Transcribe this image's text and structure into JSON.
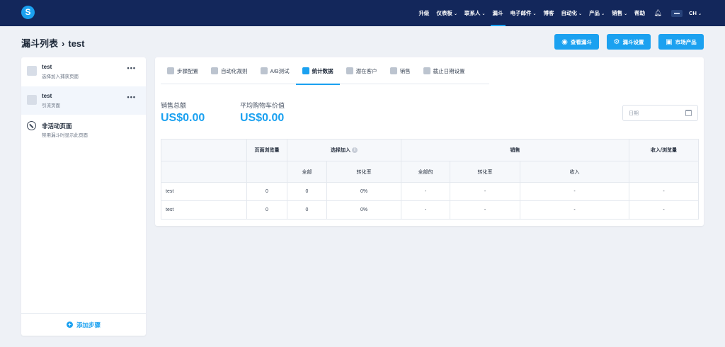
{
  "brand": {
    "logo_letter": "S",
    "accent": "#1ba1f0",
    "navbar_color": "#13275b"
  },
  "nav": {
    "items": [
      {
        "label": "升级",
        "has_menu": false,
        "active": false
      },
      {
        "label": "仪表板",
        "has_menu": true,
        "active": false
      },
      {
        "label": "联系人",
        "has_menu": true,
        "active": false
      },
      {
        "label": "漏斗",
        "has_menu": false,
        "active": true
      },
      {
        "label": "电子邮件",
        "has_menu": true,
        "active": false
      },
      {
        "label": "博客",
        "has_menu": false,
        "active": false
      },
      {
        "label": "自动化",
        "has_menu": true,
        "active": false
      },
      {
        "label": "产品",
        "has_menu": true,
        "active": false
      },
      {
        "label": "销售",
        "has_menu": true,
        "active": false
      },
      {
        "label": "帮助",
        "has_menu": false,
        "active": false
      }
    ],
    "bell_icon": "bell-icon",
    "language": "CH"
  },
  "page": {
    "breadcrumb_root": "漏斗列表",
    "breadcrumb_current": "test"
  },
  "header_buttons": {
    "view_funnel": {
      "label": "查看漏斗",
      "icon": "eye-icon"
    },
    "funnel_settings": {
      "label": "漏斗设置",
      "icon": "gear-icon"
    },
    "marketplace": {
      "label": "市场产品",
      "icon": "store-icon"
    }
  },
  "sidebar": {
    "steps": [
      {
        "title": "test",
        "subtitle": "选择加入捕获页面",
        "icon": "optin-page-icon"
      },
      {
        "title": "test",
        "subtitle": "引流页面",
        "icon": "page-icon"
      }
    ],
    "inactive": {
      "title": "非活动页面",
      "subtitle": "禁用漏斗时显示此页面",
      "icon": "inactive-icon"
    },
    "add_step_label": "添加步骤"
  },
  "tabs": [
    {
      "label": "步骤配置",
      "icon": "steps-icon"
    },
    {
      "label": "自动化规则",
      "icon": "automation-icon"
    },
    {
      "label": "A/B测试",
      "icon": "ab-test-icon"
    },
    {
      "label": "统计数据",
      "icon": "stats-icon",
      "active": true
    },
    {
      "label": "潜在客户",
      "icon": "leads-icon"
    },
    {
      "label": "销售",
      "icon": "dollar-icon"
    },
    {
      "label": "截止日期设置",
      "icon": "clock-icon"
    }
  ],
  "stats": {
    "total_sales_label": "销售总额",
    "total_sales_value": "US$0.00",
    "avg_cart_label": "平均购物车价值",
    "avg_cart_value": "US$0.00",
    "date_placeholder": "日期"
  },
  "table": {
    "groups": [
      "页面浏览量",
      "选择加入",
      "销售",
      "收入/浏览量"
    ],
    "subheaders": [
      "全部",
      "转化率",
      "全部的",
      "转化率",
      "收入"
    ],
    "rows": [
      [
        "test",
        "0",
        "0",
        "0%",
        "-",
        "-",
        "-",
        "-"
      ],
      [
        "test",
        "0",
        "0",
        "0%",
        "-",
        "-",
        "-",
        "-"
      ]
    ]
  }
}
